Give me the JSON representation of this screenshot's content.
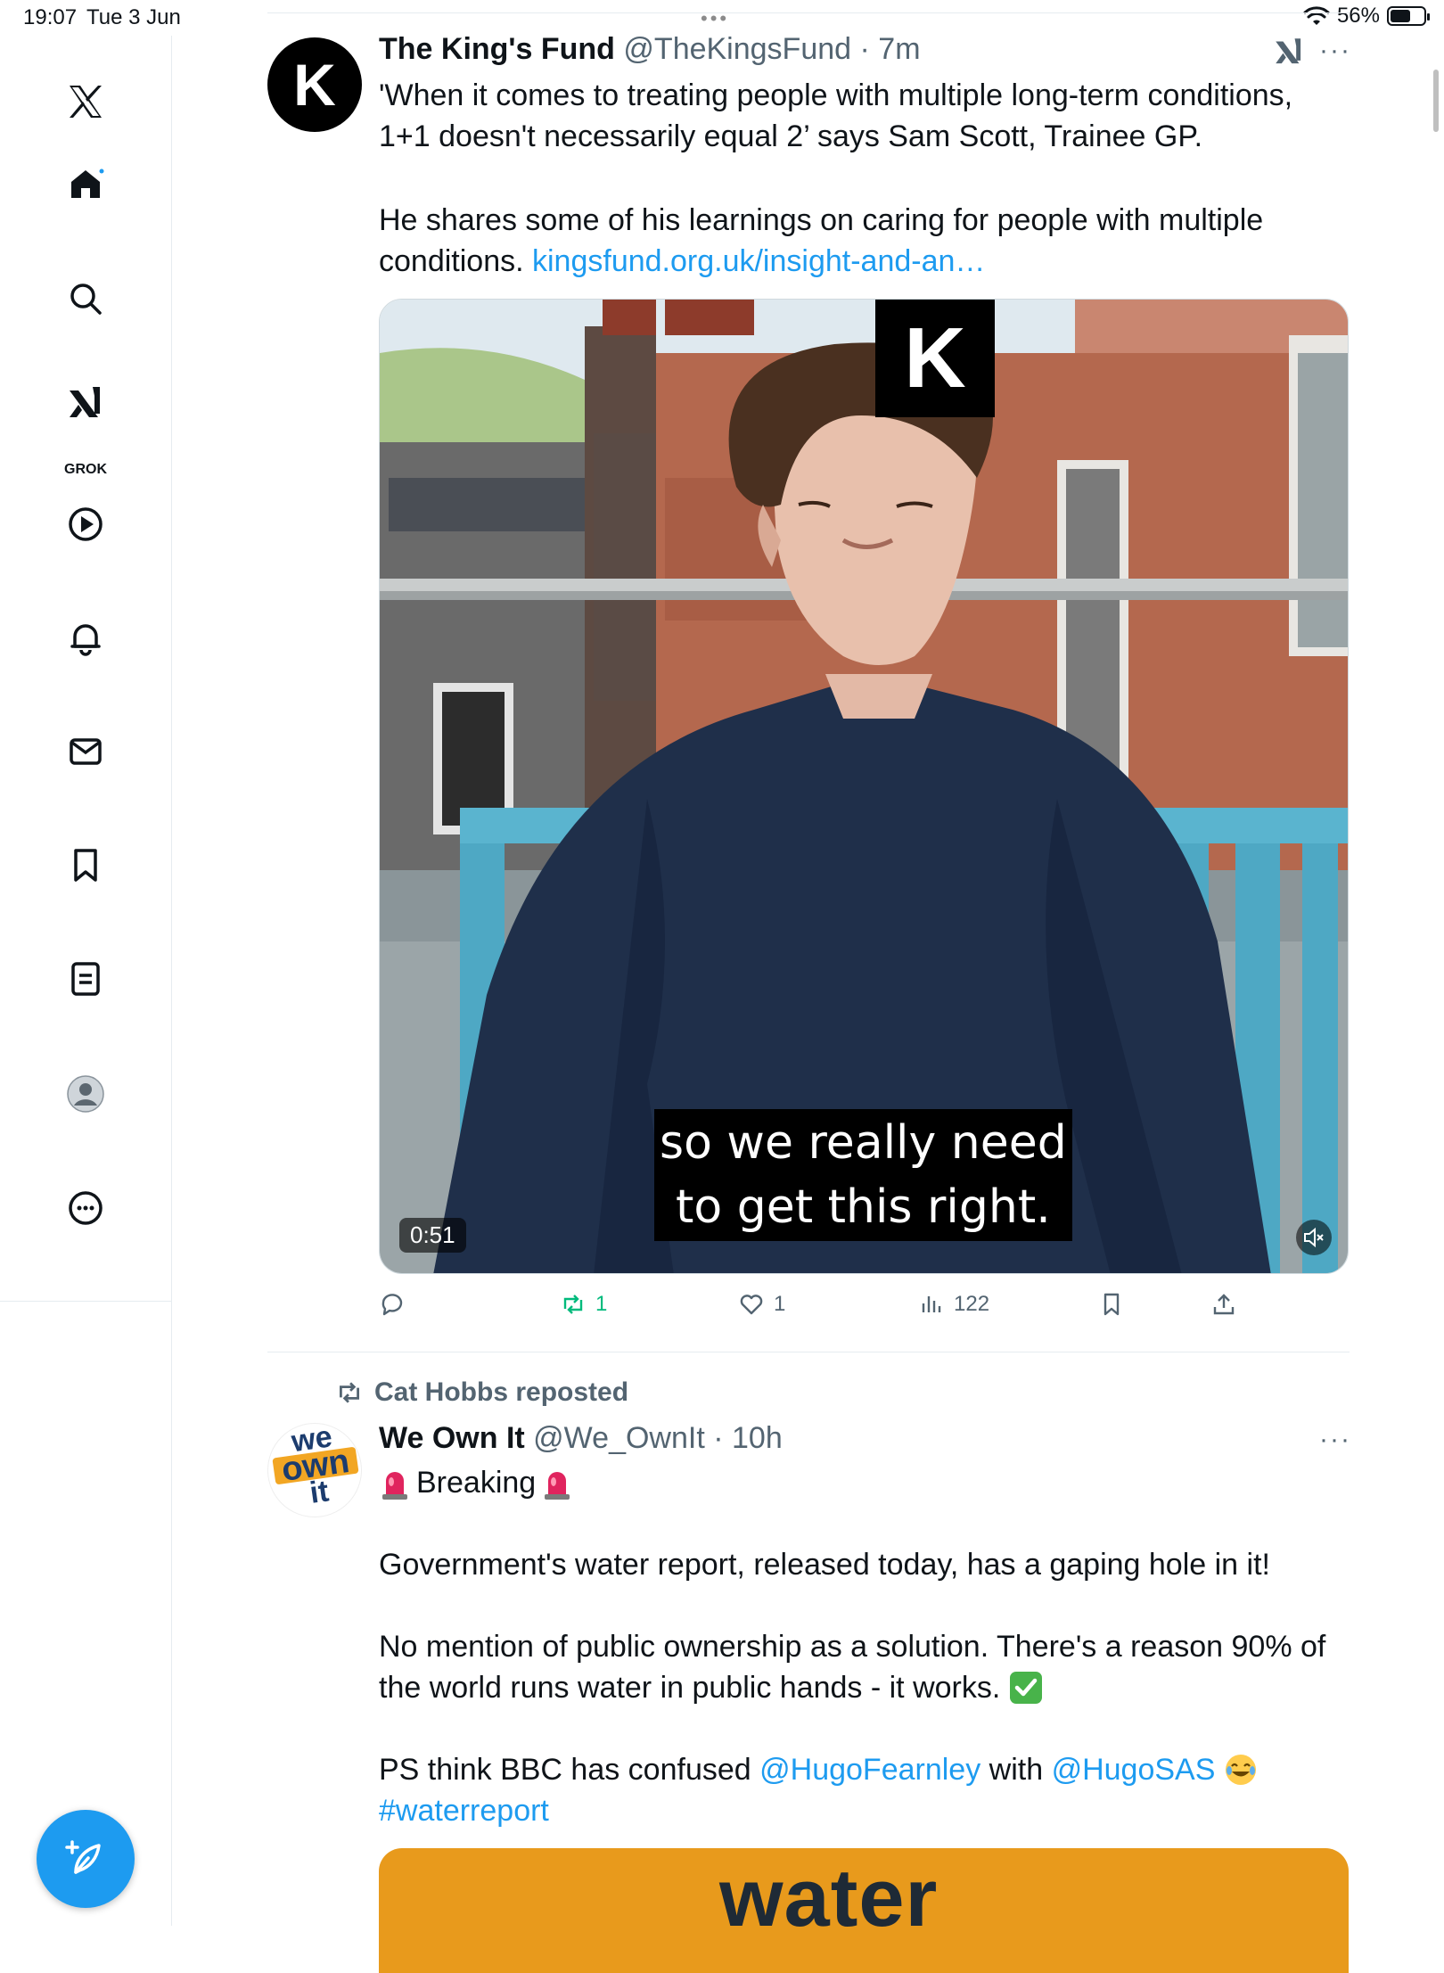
{
  "status_bar": {
    "time": "19:07",
    "date": "Tue 3 Jun",
    "battery": "56%",
    "dots": "•••"
  },
  "sidebar": {
    "items": [
      {
        "label": "Home",
        "icon": "home-icon"
      },
      {
        "label": "Search",
        "icon": "search-icon"
      },
      {
        "label": "GROK",
        "icon": "grok-icon"
      },
      {
        "label": "Video",
        "icon": "play-icon"
      },
      {
        "label": "Notifications",
        "icon": "bell-icon"
      },
      {
        "label": "Messages",
        "icon": "mail-icon"
      },
      {
        "label": "Bookmarks",
        "icon": "bookmark-icon"
      },
      {
        "label": "Lists",
        "icon": "list-icon"
      },
      {
        "label": "Profile",
        "icon": "profile-icon"
      },
      {
        "label": "More",
        "icon": "more-icon"
      }
    ],
    "grok_label": "GROK",
    "compose_icon": "compose-icon"
  },
  "tweet1": {
    "name": "The King's Fund",
    "handle": "@TheKingsFund",
    "time": "7m",
    "avatar_letter": "K",
    "text_para1": "'When it comes to treating people with multiple long-term conditions, 1+1 doesn't necessarily equal 2’ says Sam Scott, Trainee GP.",
    "text_para2": "He shares some of his learnings on caring for people with multiple conditions. ",
    "link": "kingsfund.org.uk/insight-and-an…",
    "video": {
      "logo_letter": "K",
      "caption_line1": "so we really need",
      "caption_line2": "to get this right.",
      "duration": "0:51"
    },
    "actions": {
      "replies": "",
      "reposts": "1",
      "likes": "1",
      "views": "122"
    },
    "more": "···"
  },
  "tweet2": {
    "repost_by": "Cat Hobbs reposted",
    "name": "We Own It",
    "handle": "@We_OwnIt",
    "time": "10h",
    "avatar_lines": [
      "we",
      "own",
      "it"
    ],
    "breaking": "Breaking",
    "para1": "Government's water report, released today, has a gaping hole in it!",
    "para2": "No mention of public ownership as a solution. There's a reason 90% of the world runs water in public hands - it works.",
    "ps_start": "PS think BBC has confused ",
    "mention1": "@HugoFearnley",
    "ps_mid": " with ",
    "mention2": "@HugoSAS",
    "hashtag": "#waterreport",
    "image_word": "water",
    "more": "···"
  },
  "colors": {
    "accent": "#1d9bf0",
    "repost_green": "#00ba7c",
    "muted": "#536471",
    "water_orange": "#e89a1c"
  }
}
